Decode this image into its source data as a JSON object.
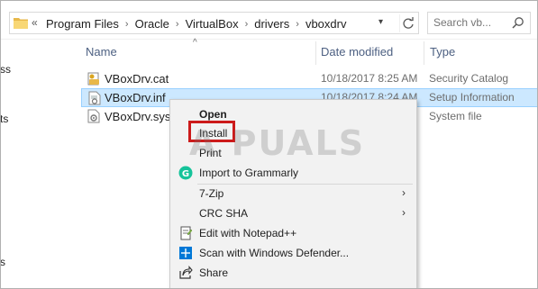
{
  "address_bar": {
    "back_glyph": "«",
    "crumbs": [
      "Program Files",
      "Oracle",
      "VirtualBox",
      "drivers",
      "vboxdrv"
    ],
    "separator": "›"
  },
  "search": {
    "placeholder": "Search vb..."
  },
  "nav_fragments": [
    "ss",
    "ts",
    "s"
  ],
  "columns": {
    "name": "Name",
    "date": "Date modified",
    "type": "Type"
  },
  "files": [
    {
      "name": "VBoxDrv.cat",
      "date": "10/18/2017 8:25 AM",
      "type": "Security Catalog",
      "icon": "catalog-icon"
    },
    {
      "name": "VBoxDrv.inf",
      "date": "10/18/2017 8:24 AM",
      "type": "Setup Information",
      "icon": "setup-info-icon",
      "selected": true
    },
    {
      "name": "VBoxDrv.sys",
      "date": "",
      "type": "System file",
      "icon": "system-file-icon"
    }
  ],
  "context_menu": {
    "items": [
      {
        "label": "Open",
        "bold": true
      },
      {
        "label": "Install",
        "highlighted": true
      },
      {
        "label": "Print"
      },
      {
        "label": "Import to Grammarly",
        "icon": "grammarly-icon"
      },
      {
        "label": "7-Zip",
        "submenu": true
      },
      {
        "label": "CRC SHA",
        "submenu": true
      },
      {
        "label": "Edit with Notepad++",
        "icon": "notepadpp-icon"
      },
      {
        "label": "Scan with Windows Defender...",
        "icon": "windows-defender-icon"
      },
      {
        "label": "Share",
        "icon": "share-icon"
      }
    ],
    "submenu_glyph": "›"
  },
  "watermark": "A PUALS",
  "colors": {
    "selection_bg": "#cce8ff",
    "selection_border": "#99d1ff",
    "menu_bg": "#f2f2f2",
    "highlight_box": "#cc1a1a",
    "header_text": "#4d6082",
    "grammarly_green": "#15c39a",
    "defender_blue": "#0078d7"
  }
}
